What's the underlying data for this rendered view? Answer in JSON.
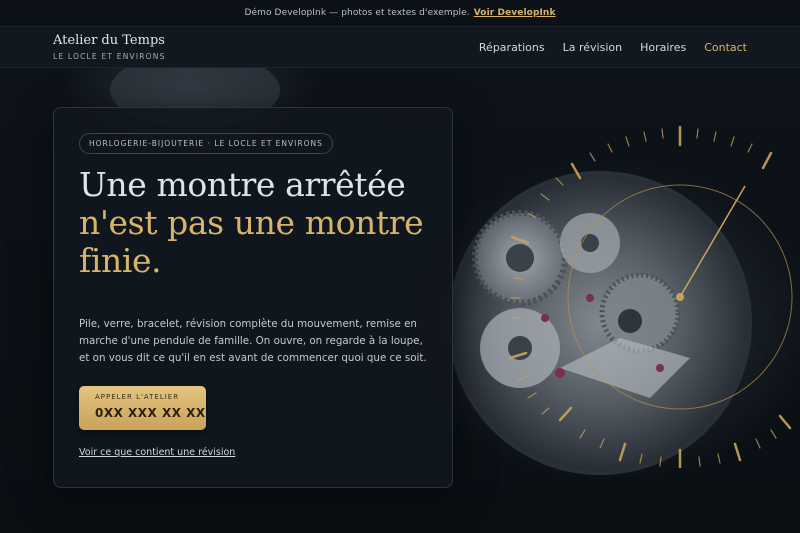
{
  "topbar": {
    "text": "Démo DevelopInk — photos et textes d'exemple.",
    "link": "Voir DevelopInk"
  },
  "brand": {
    "name": "Atelier du Temps",
    "tagline": "LE LOCLE ET ENVIRONS"
  },
  "nav": {
    "items": [
      "Réparations",
      "La révision",
      "Horaires",
      "Contact"
    ],
    "active": "Contact"
  },
  "hero": {
    "pill": "HORLOGERIE-BIJOUTERIE · LE LOCLE ET ENVIRONS",
    "headline_part1": "Une montre arrêtée ",
    "headline_part2": "n'est pas une montre finie.",
    "description": "Pile, verre, bracelet, révision complète du mouvement, remise en marche d'une pendule de famille. On ouvre, on regarde à la loupe, et on vous dit ce qu'il en est avant de commencer quoi que ce soit.",
    "cta_label": "APPELER L'ATELIER",
    "cta_phone": "0XX XXX XX XX",
    "secondary_link": "Voir ce que contient une révision"
  },
  "colors": {
    "accent": "#d8b46a",
    "background": "#0b1016",
    "card": "#11171e"
  }
}
